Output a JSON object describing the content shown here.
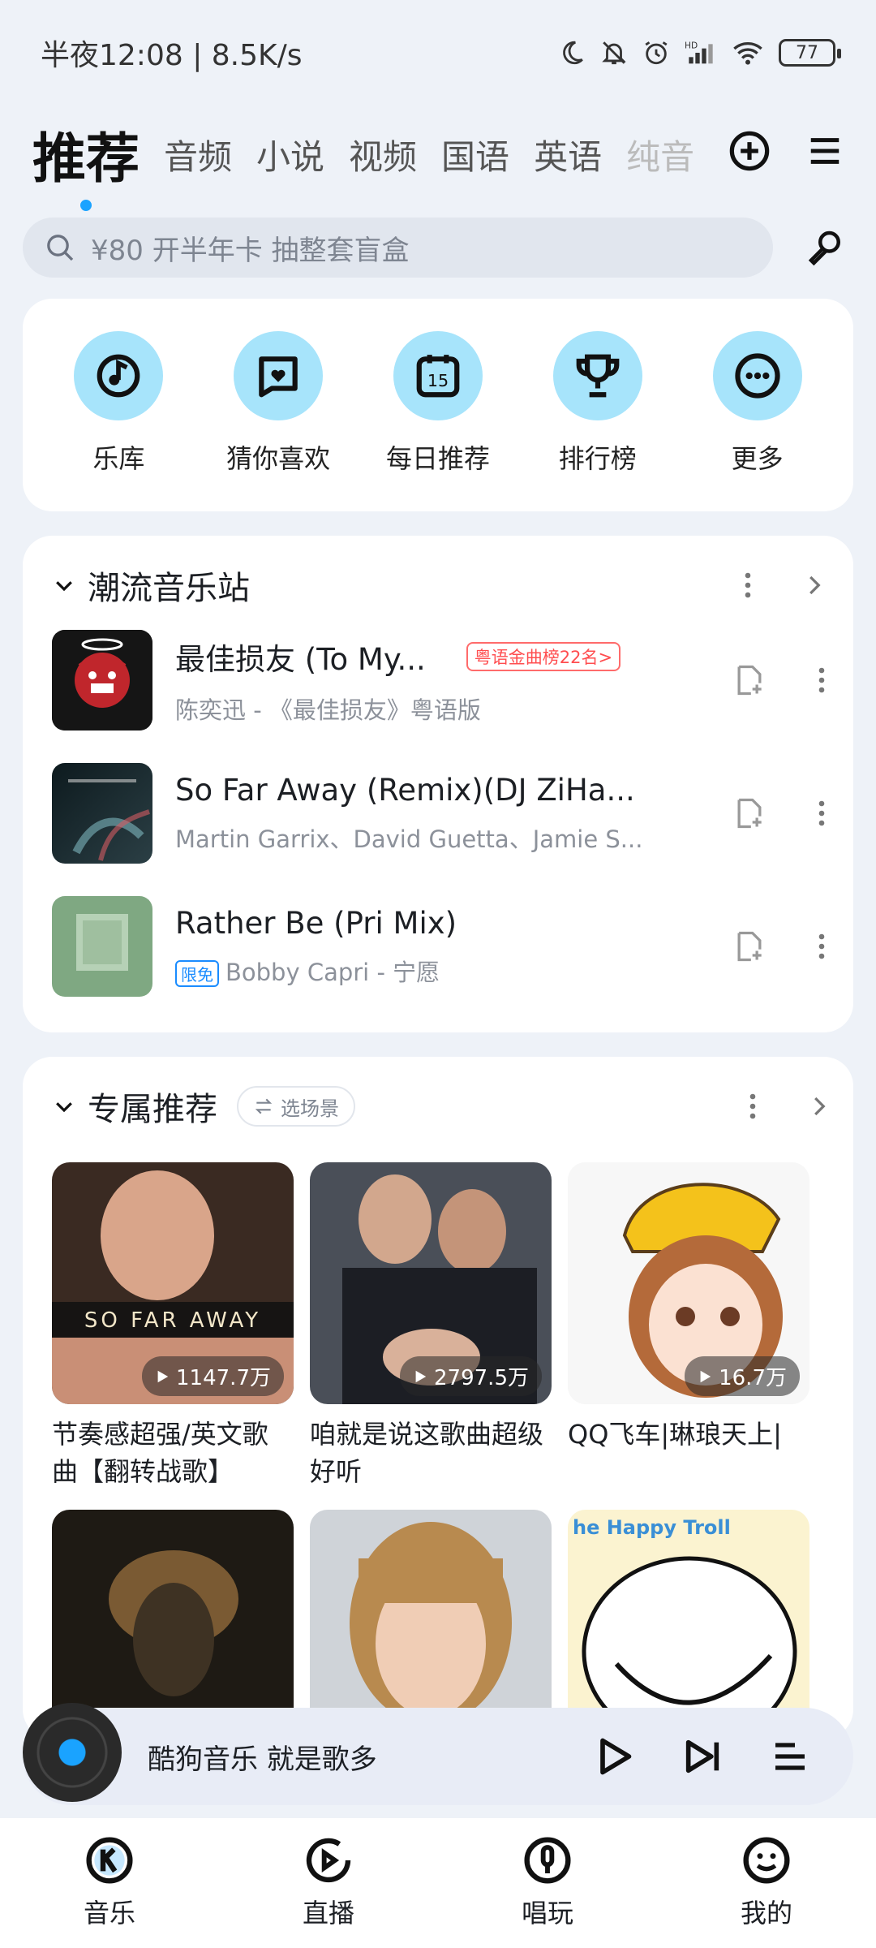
{
  "status_bar": {
    "time_speed": "半夜12:08 | 8.5K/s",
    "battery": "77"
  },
  "tabs": [
    {
      "label": "推荐",
      "active": true
    },
    {
      "label": "音频"
    },
    {
      "label": "小说"
    },
    {
      "label": "视频"
    },
    {
      "label": "国语"
    },
    {
      "label": "英语"
    },
    {
      "label": "纯音"
    }
  ],
  "search": {
    "placeholder": "¥80 开半年卡 抽整套盲盒"
  },
  "quick_menu": [
    {
      "label": "乐库",
      "icon": "music-library-icon"
    },
    {
      "label": "猜你喜欢",
      "icon": "guess-like-icon"
    },
    {
      "label": "每日推荐",
      "icon": "daily-calendar-icon",
      "day": "15"
    },
    {
      "label": "排行榜",
      "icon": "trophy-icon"
    },
    {
      "label": "更多",
      "icon": "more-dots-icon"
    }
  ],
  "trend": {
    "title": "潮流音乐站",
    "songs": [
      {
        "title": "最佳损友 (To My...",
        "subtitle": "陈奕迅 - 《最佳损友》粤语版",
        "badge": "粤语金曲榜22名>"
      },
      {
        "title": "So Far Away (Remix)(DJ ZiHa...",
        "subtitle": "Martin Garrix、David Guetta、Jamie S..."
      },
      {
        "title": "Rather Be (Pri Mix)",
        "subtitle": "Bobby Capri - 宁愿",
        "free_badge": "限免"
      }
    ]
  },
  "exclusive": {
    "title": "专属推荐",
    "scene_button": "选场景",
    "items": [
      {
        "title": "节奏感超强/英文歌曲【翻转战歌】",
        "plays": "1147.7万",
        "overlay_text": "SO FAR AWAY"
      },
      {
        "title": "咱就是说这歌曲超级好听",
        "plays": "2797.5万"
      },
      {
        "title": "QQ飞车|琳琅天上|",
        "plays": "16.7万"
      },
      {
        "title": "",
        "plays": ""
      },
      {
        "title": "",
        "plays": ""
      },
      {
        "title": "",
        "plays": "",
        "overlay_text": "he Happy Troll"
      }
    ]
  },
  "mini_player": {
    "text": "酷狗音乐  就是歌多"
  },
  "bottom_nav": [
    {
      "label": "音乐",
      "icon": "music-k-icon"
    },
    {
      "label": "直播",
      "icon": "live-icon"
    },
    {
      "label": "唱玩",
      "icon": "sing-mic-icon"
    },
    {
      "label": "我的",
      "icon": "profile-face-icon"
    }
  ]
}
